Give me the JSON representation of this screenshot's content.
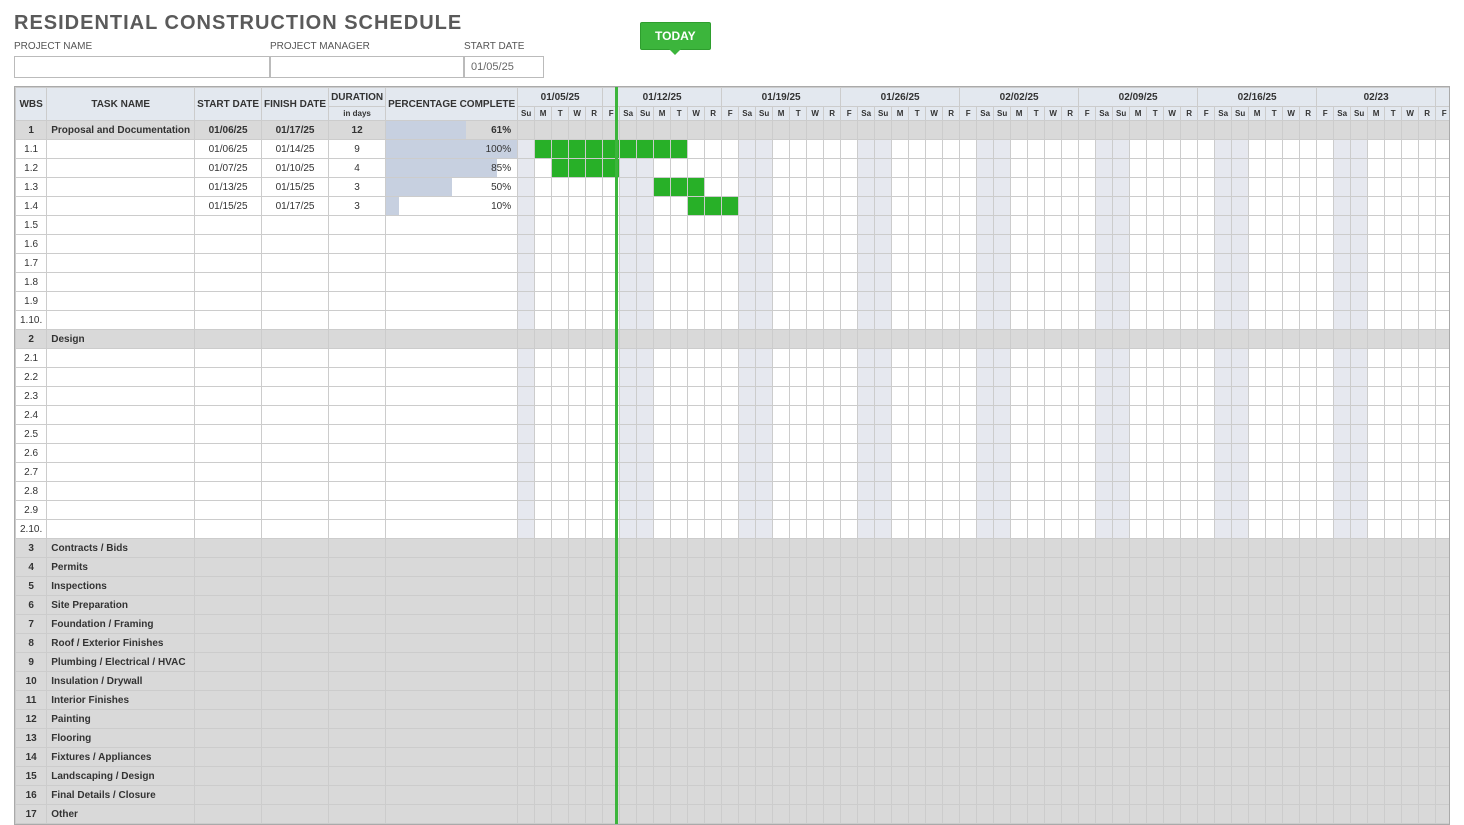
{
  "title": "RESIDENTIAL CONSTRUCTION SCHEDULE",
  "meta": {
    "projectNameLabel": "PROJECT NAME",
    "projectManagerLabel": "PROJECT MANAGER",
    "startDateLabel": "START DATE",
    "startDateValue": "01/05/25"
  },
  "todayLabel": "TODAY",
  "columns": {
    "wbs": "WBS",
    "task": "TASK NAME",
    "start": "START DATE",
    "finish": "FINISH DATE",
    "duration": "DURATION",
    "durationSub": "in days",
    "percent": "PERCENTAGE COMPLETE"
  },
  "weekHeaders": [
    "01/05/25",
    "01/12/25",
    "01/19/25",
    "01/26/25",
    "02/02/25",
    "02/09/25",
    "02/16/25",
    "02/23"
  ],
  "dayLabels": [
    "Su",
    "M",
    "T",
    "W",
    "R",
    "F",
    "Sa"
  ],
  "firstWeekDays": [
    "Su",
    "M",
    "T",
    "W",
    "R"
  ],
  "rows": [
    {
      "wbs": "1",
      "task": "Proposal and Documentation",
      "start": "01/06/25",
      "finish": "01/17/25",
      "duration": "12",
      "percent": 61,
      "section": true
    },
    {
      "wbs": "1.1",
      "task": "",
      "start": "01/06/25",
      "finish": "01/14/25",
      "duration": "9",
      "percent": 100,
      "barStart": 1,
      "barEnd": 9
    },
    {
      "wbs": "1.2",
      "task": "",
      "start": "01/07/25",
      "finish": "01/10/25",
      "duration": "4",
      "percent": 85,
      "barStart": 2,
      "barEnd": 5
    },
    {
      "wbs": "1.3",
      "task": "",
      "start": "01/13/25",
      "finish": "01/15/25",
      "duration": "3",
      "percent": 50,
      "barStart": 8,
      "barEnd": 10
    },
    {
      "wbs": "1.4",
      "task": "",
      "start": "01/15/25",
      "finish": "01/17/25",
      "duration": "3",
      "percent": 10,
      "barStart": 10,
      "barEnd": 12
    },
    {
      "wbs": "1.5",
      "task": ""
    },
    {
      "wbs": "1.6",
      "task": ""
    },
    {
      "wbs": "1.7",
      "task": ""
    },
    {
      "wbs": "1.8",
      "task": ""
    },
    {
      "wbs": "1.9",
      "task": ""
    },
    {
      "wbs": "1.10.",
      "task": ""
    },
    {
      "wbs": "2",
      "task": "Design",
      "section": true
    },
    {
      "wbs": "2.1",
      "task": ""
    },
    {
      "wbs": "2.2",
      "task": ""
    },
    {
      "wbs": "2.3",
      "task": ""
    },
    {
      "wbs": "2.4",
      "task": ""
    },
    {
      "wbs": "2.5",
      "task": ""
    },
    {
      "wbs": "2.6",
      "task": ""
    },
    {
      "wbs": "2.7",
      "task": ""
    },
    {
      "wbs": "2.8",
      "task": ""
    },
    {
      "wbs": "2.9",
      "task": ""
    },
    {
      "wbs": "2.10.",
      "task": ""
    },
    {
      "wbs": "3",
      "task": "Contracts / Bids",
      "section": true
    },
    {
      "wbs": "4",
      "task": "Permits",
      "section": true
    },
    {
      "wbs": "5",
      "task": "Inspections",
      "section": true
    },
    {
      "wbs": "6",
      "task": "Site Preparation",
      "section": true
    },
    {
      "wbs": "7",
      "task": "Foundation / Framing",
      "section": true
    },
    {
      "wbs": "8",
      "task": "Roof / Exterior Finishes",
      "section": true
    },
    {
      "wbs": "9",
      "task": "Plumbing / Electrical / HVAC",
      "section": true
    },
    {
      "wbs": "10",
      "task": "Insulation / Drywall",
      "section": true
    },
    {
      "wbs": "11",
      "task": "Interior Finishes",
      "section": true
    },
    {
      "wbs": "12",
      "task": "Painting",
      "section": true
    },
    {
      "wbs": "13",
      "task": "Flooring",
      "section": true
    },
    {
      "wbs": "14",
      "task": "Fixtures / Appliances",
      "section": true
    },
    {
      "wbs": "15",
      "task": "Landscaping / Design",
      "section": true
    },
    {
      "wbs": "16",
      "task": "Final Details / Closure",
      "section": true
    },
    {
      "wbs": "17",
      "task": "Other",
      "section": true
    }
  ],
  "chart_data": {
    "type": "gantt",
    "title": "Residential Construction Schedule",
    "start_date": "01/05/25",
    "today_day_index": 5,
    "tasks": [
      {
        "wbs": "1.1",
        "start": "01/06/25",
        "finish": "01/14/25",
        "duration": 9,
        "percent_complete": 100
      },
      {
        "wbs": "1.2",
        "start": "01/07/25",
        "finish": "01/10/25",
        "duration": 4,
        "percent_complete": 85
      },
      {
        "wbs": "1.3",
        "start": "01/13/25",
        "finish": "01/15/25",
        "duration": 3,
        "percent_complete": 50
      },
      {
        "wbs": "1.4",
        "start": "01/15/25",
        "finish": "01/17/25",
        "duration": 3,
        "percent_complete": 10
      }
    ]
  }
}
